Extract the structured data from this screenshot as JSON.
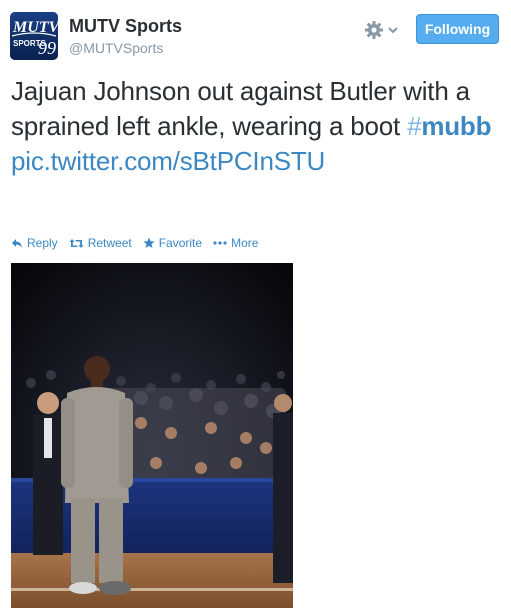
{
  "account": {
    "name": "MUTV Sports",
    "handle": "@MUTVSports",
    "avatar_text_top": "MUTV",
    "avatar_text_bottom": "SPORTS",
    "avatar_number": "99"
  },
  "follow_button": {
    "label": "Following"
  },
  "tweet": {
    "text_main": "Jajuan Johnson out against Butler with a sprained left ankle, wearing a boot ",
    "hashtag_symbol": "#",
    "hashtag": "mubb",
    "link": "pic.twitter.com/sBtPCInSTU"
  },
  "actions": {
    "reply": "Reply",
    "retweet": "Retweet",
    "favorite": "Favorite",
    "more": "More"
  },
  "colors": {
    "link": "#3b88c3",
    "button": "#55acee",
    "name": "#292f33",
    "muted": "#8899a6"
  },
  "icons": [
    "gear-icon",
    "chevron-down-icon",
    "reply-icon",
    "retweet-icon",
    "star-icon",
    "ellipsis-icon"
  ]
}
